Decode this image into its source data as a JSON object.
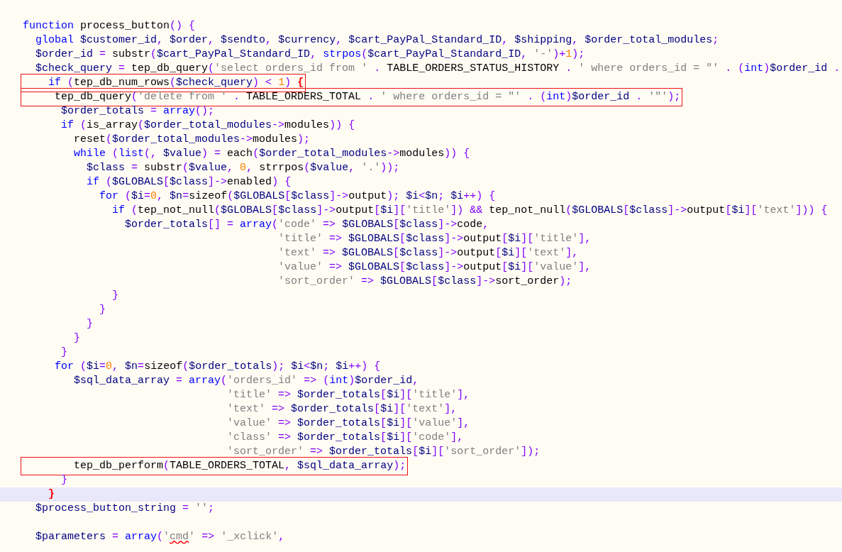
{
  "code_lines": [
    {
      "tokens": [
        {
          "text": "function",
          "kind": "kw"
        },
        {
          "text": " process_button",
          "kind": "fn"
        },
        {
          "text": "() {",
          "kind": "op"
        }
      ]
    },
    {
      "tokens": [
        {
          "text": "  global",
          "kind": "kw"
        },
        {
          "text": " $customer_id",
          "kind": "var"
        },
        {
          "text": ", ",
          "kind": "op"
        },
        {
          "text": "$order",
          "kind": "var"
        },
        {
          "text": ", ",
          "kind": "op"
        },
        {
          "text": "$sendto",
          "kind": "var"
        },
        {
          "text": ", ",
          "kind": "op"
        },
        {
          "text": "$currency",
          "kind": "var"
        },
        {
          "text": ", ",
          "kind": "op"
        },
        {
          "text": "$cart_PayPal_Standard_ID",
          "kind": "var"
        },
        {
          "text": ", ",
          "kind": "op"
        },
        {
          "text": "$shipping",
          "kind": "var"
        },
        {
          "text": ", ",
          "kind": "op"
        },
        {
          "text": "$order_total_modules",
          "kind": "var"
        },
        {
          "text": ";",
          "kind": "op"
        }
      ]
    },
    {
      "tokens": [
        {
          "text": "  $order_id",
          "kind": "var"
        },
        {
          "text": " = ",
          "kind": "op"
        },
        {
          "text": "substr",
          "kind": "fn"
        },
        {
          "text": "(",
          "kind": "op"
        },
        {
          "text": "$cart_PayPal_Standard_ID",
          "kind": "var"
        },
        {
          "text": ", ",
          "kind": "op"
        },
        {
          "text": "strpos",
          "kind": "kw"
        },
        {
          "text": "(",
          "kind": "op"
        },
        {
          "text": "$cart_PayPal_Standard_ID",
          "kind": "var"
        },
        {
          "text": ", ",
          "kind": "op"
        },
        {
          "text": "'-'",
          "kind": "str"
        },
        {
          "text": ")+",
          "kind": "op"
        },
        {
          "text": "1",
          "kind": "num"
        },
        {
          "text": ");",
          "kind": "op"
        }
      ]
    },
    {
      "tokens": [
        {
          "text": "  $check_query",
          "kind": "var"
        },
        {
          "text": " = ",
          "kind": "op"
        },
        {
          "text": "tep_db_query",
          "kind": "fn"
        },
        {
          "text": "(",
          "kind": "op"
        },
        {
          "text": "'select orders_id from '",
          "kind": "str"
        },
        {
          "text": " . ",
          "kind": "op"
        },
        {
          "text": "TABLE_ORDERS_STATUS_HISTORY",
          "kind": "fn"
        },
        {
          "text": " . ",
          "kind": "op"
        },
        {
          "text": "' where orders_id = \"'",
          "kind": "str"
        },
        {
          "text": " . (",
          "kind": "op"
        },
        {
          "text": "int",
          "kind": "kw"
        },
        {
          "text": ")",
          "kind": "op"
        },
        {
          "text": "$order_id",
          "kind": "var"
        },
        {
          "text": " .",
          "kind": "op"
        }
      ]
    },
    {
      "boxed": true,
      "tokens": [
        {
          "text": "    if",
          "kind": "kw"
        },
        {
          "text": " (",
          "kind": "op"
        },
        {
          "text": "tep_db_num_rows",
          "kind": "fn"
        },
        {
          "text": "(",
          "kind": "op"
        },
        {
          "text": "$check_query",
          "kind": "var"
        },
        {
          "text": ") < ",
          "kind": "op"
        },
        {
          "text": "1",
          "kind": "num"
        },
        {
          "text": ") ",
          "kind": "op"
        },
        {
          "text": "{",
          "kind": "match"
        }
      ]
    },
    {
      "boxed": true,
      "tokens": [
        {
          "text": "     tep_db_query",
          "kind": "fn"
        },
        {
          "text": "(",
          "kind": "op"
        },
        {
          "text": "'delete from '",
          "kind": "str"
        },
        {
          "text": " . ",
          "kind": "op"
        },
        {
          "text": "TABLE_ORDERS_TOTAL",
          "kind": "fn"
        },
        {
          "text": " . ",
          "kind": "op"
        },
        {
          "text": "' where orders_id = \"'",
          "kind": "str"
        },
        {
          "text": " . (",
          "kind": "op"
        },
        {
          "text": "int",
          "kind": "kw"
        },
        {
          "text": ")",
          "kind": "op"
        },
        {
          "text": "$order_id",
          "kind": "var"
        },
        {
          "text": " . ",
          "kind": "op"
        },
        {
          "text": "'\"'",
          "kind": "str"
        },
        {
          "text": ");",
          "kind": "op"
        }
      ]
    },
    {
      "tokens": [
        {
          "text": "      $order_totals",
          "kind": "var"
        },
        {
          "text": " = ",
          "kind": "op"
        },
        {
          "text": "array",
          "kind": "kw"
        },
        {
          "text": "();",
          "kind": "op"
        }
      ]
    },
    {
      "tokens": [
        {
          "text": "      if",
          "kind": "kw"
        },
        {
          "text": " (",
          "kind": "op"
        },
        {
          "text": "is_array",
          "kind": "fn"
        },
        {
          "text": "(",
          "kind": "op"
        },
        {
          "text": "$order_total_modules",
          "kind": "var"
        },
        {
          "text": "->",
          "kind": "op"
        },
        {
          "text": "modules",
          "kind": "fn"
        },
        {
          "text": ")) {",
          "kind": "op"
        }
      ]
    },
    {
      "tokens": [
        {
          "text": "        reset",
          "kind": "fn"
        },
        {
          "text": "(",
          "kind": "op"
        },
        {
          "text": "$order_total_modules",
          "kind": "var"
        },
        {
          "text": "->",
          "kind": "op"
        },
        {
          "text": "modules",
          "kind": "fn"
        },
        {
          "text": ");",
          "kind": "op"
        }
      ]
    },
    {
      "tokens": [
        {
          "text": "        while",
          "kind": "kw"
        },
        {
          "text": " (",
          "kind": "op"
        },
        {
          "text": "list",
          "kind": "kw"
        },
        {
          "text": "(, ",
          "kind": "op"
        },
        {
          "text": "$value",
          "kind": "var"
        },
        {
          "text": ") = ",
          "kind": "op"
        },
        {
          "text": "each",
          "kind": "fn"
        },
        {
          "text": "(",
          "kind": "op"
        },
        {
          "text": "$order_total_modules",
          "kind": "var"
        },
        {
          "text": "->",
          "kind": "op"
        },
        {
          "text": "modules",
          "kind": "fn"
        },
        {
          "text": ")) {",
          "kind": "op"
        }
      ]
    },
    {
      "tokens": [
        {
          "text": "          $class",
          "kind": "var"
        },
        {
          "text": " = ",
          "kind": "op"
        },
        {
          "text": "substr",
          "kind": "fn"
        },
        {
          "text": "(",
          "kind": "op"
        },
        {
          "text": "$value",
          "kind": "var"
        },
        {
          "text": ", ",
          "kind": "op"
        },
        {
          "text": "0",
          "kind": "num"
        },
        {
          "text": ", ",
          "kind": "op"
        },
        {
          "text": "strrpos",
          "kind": "fn"
        },
        {
          "text": "(",
          "kind": "op"
        },
        {
          "text": "$value",
          "kind": "var"
        },
        {
          "text": ", ",
          "kind": "op"
        },
        {
          "text": "'.'",
          "kind": "str"
        },
        {
          "text": "));",
          "kind": "op"
        }
      ]
    },
    {
      "tokens": [
        {
          "text": "          if",
          "kind": "kw"
        },
        {
          "text": " (",
          "kind": "op"
        },
        {
          "text": "$GLOBALS",
          "kind": "var"
        },
        {
          "text": "[",
          "kind": "op"
        },
        {
          "text": "$class",
          "kind": "var"
        },
        {
          "text": "]->",
          "kind": "op"
        },
        {
          "text": "enabled",
          "kind": "fn"
        },
        {
          "text": ") {",
          "kind": "op"
        }
      ]
    },
    {
      "tokens": [
        {
          "text": "            for",
          "kind": "kw"
        },
        {
          "text": " (",
          "kind": "op"
        },
        {
          "text": "$i",
          "kind": "var"
        },
        {
          "text": "=",
          "kind": "op"
        },
        {
          "text": "0",
          "kind": "num"
        },
        {
          "text": ", ",
          "kind": "op"
        },
        {
          "text": "$n",
          "kind": "var"
        },
        {
          "text": "=",
          "kind": "op"
        },
        {
          "text": "sizeof",
          "kind": "fn"
        },
        {
          "text": "(",
          "kind": "op"
        },
        {
          "text": "$GLOBALS",
          "kind": "var"
        },
        {
          "text": "[",
          "kind": "op"
        },
        {
          "text": "$class",
          "kind": "var"
        },
        {
          "text": "]->",
          "kind": "op"
        },
        {
          "text": "output",
          "kind": "fn"
        },
        {
          "text": "); ",
          "kind": "op"
        },
        {
          "text": "$i",
          "kind": "var"
        },
        {
          "text": "<",
          "kind": "op"
        },
        {
          "text": "$n",
          "kind": "var"
        },
        {
          "text": "; ",
          "kind": "op"
        },
        {
          "text": "$i",
          "kind": "var"
        },
        {
          "text": "++) {",
          "kind": "op"
        }
      ]
    },
    {
      "tokens": [
        {
          "text": "              if",
          "kind": "kw"
        },
        {
          "text": " (",
          "kind": "op"
        },
        {
          "text": "tep_not_null",
          "kind": "fn"
        },
        {
          "text": "(",
          "kind": "op"
        },
        {
          "text": "$GLOBALS",
          "kind": "var"
        },
        {
          "text": "[",
          "kind": "op"
        },
        {
          "text": "$class",
          "kind": "var"
        },
        {
          "text": "]->",
          "kind": "op"
        },
        {
          "text": "output",
          "kind": "fn"
        },
        {
          "text": "[",
          "kind": "op"
        },
        {
          "text": "$i",
          "kind": "var"
        },
        {
          "text": "][",
          "kind": "op"
        },
        {
          "text": "'title'",
          "kind": "str"
        },
        {
          "text": "]) && ",
          "kind": "op"
        },
        {
          "text": "tep_not_null",
          "kind": "fn"
        },
        {
          "text": "(",
          "kind": "op"
        },
        {
          "text": "$GLOBALS",
          "kind": "var"
        },
        {
          "text": "[",
          "kind": "op"
        },
        {
          "text": "$class",
          "kind": "var"
        },
        {
          "text": "]->",
          "kind": "op"
        },
        {
          "text": "output",
          "kind": "fn"
        },
        {
          "text": "[",
          "kind": "op"
        },
        {
          "text": "$i",
          "kind": "var"
        },
        {
          "text": "][",
          "kind": "op"
        },
        {
          "text": "'text'",
          "kind": "str"
        },
        {
          "text": "])) {",
          "kind": "op"
        }
      ]
    },
    {
      "tokens": [
        {
          "text": "                $order_totals",
          "kind": "var"
        },
        {
          "text": "[] = ",
          "kind": "op"
        },
        {
          "text": "array",
          "kind": "kw"
        },
        {
          "text": "(",
          "kind": "op"
        },
        {
          "text": "'code'",
          "kind": "str"
        },
        {
          "text": " => ",
          "kind": "op"
        },
        {
          "text": "$GLOBALS",
          "kind": "var"
        },
        {
          "text": "[",
          "kind": "op"
        },
        {
          "text": "$class",
          "kind": "var"
        },
        {
          "text": "]->",
          "kind": "op"
        },
        {
          "text": "code",
          "kind": "fn"
        },
        {
          "text": ",",
          "kind": "op"
        }
      ]
    },
    {
      "tokens": [
        {
          "text": "                                        'title'",
          "kind": "str"
        },
        {
          "text": " => ",
          "kind": "op"
        },
        {
          "text": "$GLOBALS",
          "kind": "var"
        },
        {
          "text": "[",
          "kind": "op"
        },
        {
          "text": "$class",
          "kind": "var"
        },
        {
          "text": "]->",
          "kind": "op"
        },
        {
          "text": "output",
          "kind": "fn"
        },
        {
          "text": "[",
          "kind": "op"
        },
        {
          "text": "$i",
          "kind": "var"
        },
        {
          "text": "][",
          "kind": "op"
        },
        {
          "text": "'title'",
          "kind": "str"
        },
        {
          "text": "],",
          "kind": "op"
        }
      ]
    },
    {
      "tokens": [
        {
          "text": "                                        'text'",
          "kind": "str"
        },
        {
          "text": " => ",
          "kind": "op"
        },
        {
          "text": "$GLOBALS",
          "kind": "var"
        },
        {
          "text": "[",
          "kind": "op"
        },
        {
          "text": "$class",
          "kind": "var"
        },
        {
          "text": "]->",
          "kind": "op"
        },
        {
          "text": "output",
          "kind": "fn"
        },
        {
          "text": "[",
          "kind": "op"
        },
        {
          "text": "$i",
          "kind": "var"
        },
        {
          "text": "][",
          "kind": "op"
        },
        {
          "text": "'text'",
          "kind": "str"
        },
        {
          "text": "],",
          "kind": "op"
        }
      ]
    },
    {
      "tokens": [
        {
          "text": "                                        'value'",
          "kind": "str"
        },
        {
          "text": " => ",
          "kind": "op"
        },
        {
          "text": "$GLOBALS",
          "kind": "var"
        },
        {
          "text": "[",
          "kind": "op"
        },
        {
          "text": "$class",
          "kind": "var"
        },
        {
          "text": "]->",
          "kind": "op"
        },
        {
          "text": "output",
          "kind": "fn"
        },
        {
          "text": "[",
          "kind": "op"
        },
        {
          "text": "$i",
          "kind": "var"
        },
        {
          "text": "][",
          "kind": "op"
        },
        {
          "text": "'value'",
          "kind": "str"
        },
        {
          "text": "],",
          "kind": "op"
        }
      ]
    },
    {
      "tokens": [
        {
          "text": "                                        'sort_order'",
          "kind": "str"
        },
        {
          "text": " => ",
          "kind": "op"
        },
        {
          "text": "$GLOBALS",
          "kind": "var"
        },
        {
          "text": "[",
          "kind": "op"
        },
        {
          "text": "$class",
          "kind": "var"
        },
        {
          "text": "]->",
          "kind": "op"
        },
        {
          "text": "sort_order",
          "kind": "fn"
        },
        {
          "text": ");",
          "kind": "op"
        }
      ]
    },
    {
      "tokens": [
        {
          "text": "              }",
          "kind": "op"
        }
      ]
    },
    {
      "tokens": [
        {
          "text": "            }",
          "kind": "op"
        }
      ]
    },
    {
      "tokens": [
        {
          "text": "          }",
          "kind": "op"
        }
      ]
    },
    {
      "tokens": [
        {
          "text": "        }",
          "kind": "op"
        }
      ]
    },
    {
      "tokens": [
        {
          "text": "      }",
          "kind": "op"
        }
      ]
    },
    {
      "tokens": [
        {
          "text": "     for",
          "kind": "kw"
        },
        {
          "text": " (",
          "kind": "op"
        },
        {
          "text": "$i",
          "kind": "var"
        },
        {
          "text": "=",
          "kind": "op"
        },
        {
          "text": "0",
          "kind": "num"
        },
        {
          "text": ", ",
          "kind": "op"
        },
        {
          "text": "$n",
          "kind": "var"
        },
        {
          "text": "=",
          "kind": "op"
        },
        {
          "text": "sizeof",
          "kind": "fn"
        },
        {
          "text": "(",
          "kind": "op"
        },
        {
          "text": "$order_totals",
          "kind": "var"
        },
        {
          "text": "); ",
          "kind": "op"
        },
        {
          "text": "$i",
          "kind": "var"
        },
        {
          "text": "<",
          "kind": "op"
        },
        {
          "text": "$n",
          "kind": "var"
        },
        {
          "text": "; ",
          "kind": "op"
        },
        {
          "text": "$i",
          "kind": "var"
        },
        {
          "text": "++) {",
          "kind": "op"
        }
      ]
    },
    {
      "tokens": [
        {
          "text": "        $sql_data_array",
          "kind": "var"
        },
        {
          "text": " = ",
          "kind": "op"
        },
        {
          "text": "array",
          "kind": "kw"
        },
        {
          "text": "(",
          "kind": "op"
        },
        {
          "text": "'orders_id'",
          "kind": "str"
        },
        {
          "text": " => (",
          "kind": "op"
        },
        {
          "text": "int",
          "kind": "kw"
        },
        {
          "text": ")",
          "kind": "op"
        },
        {
          "text": "$order_id",
          "kind": "var"
        },
        {
          "text": ",",
          "kind": "op"
        }
      ]
    },
    {
      "tokens": [
        {
          "text": "                                'title'",
          "kind": "str"
        },
        {
          "text": " => ",
          "kind": "op"
        },
        {
          "text": "$order_totals",
          "kind": "var"
        },
        {
          "text": "[",
          "kind": "op"
        },
        {
          "text": "$i",
          "kind": "var"
        },
        {
          "text": "][",
          "kind": "op"
        },
        {
          "text": "'title'",
          "kind": "str"
        },
        {
          "text": "],",
          "kind": "op"
        }
      ]
    },
    {
      "tokens": [
        {
          "text": "                                'text'",
          "kind": "str"
        },
        {
          "text": " => ",
          "kind": "op"
        },
        {
          "text": "$order_totals",
          "kind": "var"
        },
        {
          "text": "[",
          "kind": "op"
        },
        {
          "text": "$i",
          "kind": "var"
        },
        {
          "text": "][",
          "kind": "op"
        },
        {
          "text": "'text'",
          "kind": "str"
        },
        {
          "text": "],",
          "kind": "op"
        }
      ]
    },
    {
      "tokens": [
        {
          "text": "                                'value'",
          "kind": "str"
        },
        {
          "text": " => ",
          "kind": "op"
        },
        {
          "text": "$order_totals",
          "kind": "var"
        },
        {
          "text": "[",
          "kind": "op"
        },
        {
          "text": "$i",
          "kind": "var"
        },
        {
          "text": "][",
          "kind": "op"
        },
        {
          "text": "'value'",
          "kind": "str"
        },
        {
          "text": "],",
          "kind": "op"
        }
      ]
    },
    {
      "tokens": [
        {
          "text": "                                'class'",
          "kind": "str"
        },
        {
          "text": " => ",
          "kind": "op"
        },
        {
          "text": "$order_totals",
          "kind": "var"
        },
        {
          "text": "[",
          "kind": "op"
        },
        {
          "text": "$i",
          "kind": "var"
        },
        {
          "text": "][",
          "kind": "op"
        },
        {
          "text": "'code'",
          "kind": "str"
        },
        {
          "text": "],",
          "kind": "op"
        }
      ]
    },
    {
      "tokens": [
        {
          "text": "                                'sort_order'",
          "kind": "str"
        },
        {
          "text": " => ",
          "kind": "op"
        },
        {
          "text": "$order_totals",
          "kind": "var"
        },
        {
          "text": "[",
          "kind": "op"
        },
        {
          "text": "$i",
          "kind": "var"
        },
        {
          "text": "][",
          "kind": "op"
        },
        {
          "text": "'sort_order'",
          "kind": "str"
        },
        {
          "text": "]);",
          "kind": "op"
        }
      ]
    },
    {
      "boxed": true,
      "tokens": [
        {
          "text": "        tep_db_perform",
          "kind": "fn"
        },
        {
          "text": "(",
          "kind": "op"
        },
        {
          "text": "TABLE_ORDERS_TOTAL",
          "kind": "fn"
        },
        {
          "text": ", ",
          "kind": "op"
        },
        {
          "text": "$sql_data_array",
          "kind": "var"
        },
        {
          "text": ");",
          "kind": "op"
        }
      ]
    },
    {
      "tokens": [
        {
          "text": "      }",
          "kind": "op"
        }
      ]
    },
    {
      "current": true,
      "tokens": [
        {
          "text": "    }",
          "kind": "match"
        }
      ]
    },
    {
      "tokens": [
        {
          "text": "  $process_button_string",
          "kind": "var"
        },
        {
          "text": " = ",
          "kind": "op"
        },
        {
          "text": "''",
          "kind": "str"
        },
        {
          "text": ";",
          "kind": "op"
        }
      ]
    },
    {
      "blank_line_before": true,
      "tokens": [
        {
          "text": "  $parameters",
          "kind": "var"
        },
        {
          "text": " = ",
          "kind": "op"
        },
        {
          "text": "array",
          "kind": "kw"
        },
        {
          "text": "(",
          "kind": "op"
        },
        {
          "text": "'",
          "kind": "str"
        },
        {
          "text": "cmd",
          "kind": "str",
          "misspelled": true
        },
        {
          "text": "'",
          "kind": "str"
        },
        {
          "text": " => ",
          "kind": "op"
        },
        {
          "text": "'_xclick'",
          "kind": "str"
        },
        {
          "text": ",",
          "kind": "op"
        }
      ]
    }
  ]
}
